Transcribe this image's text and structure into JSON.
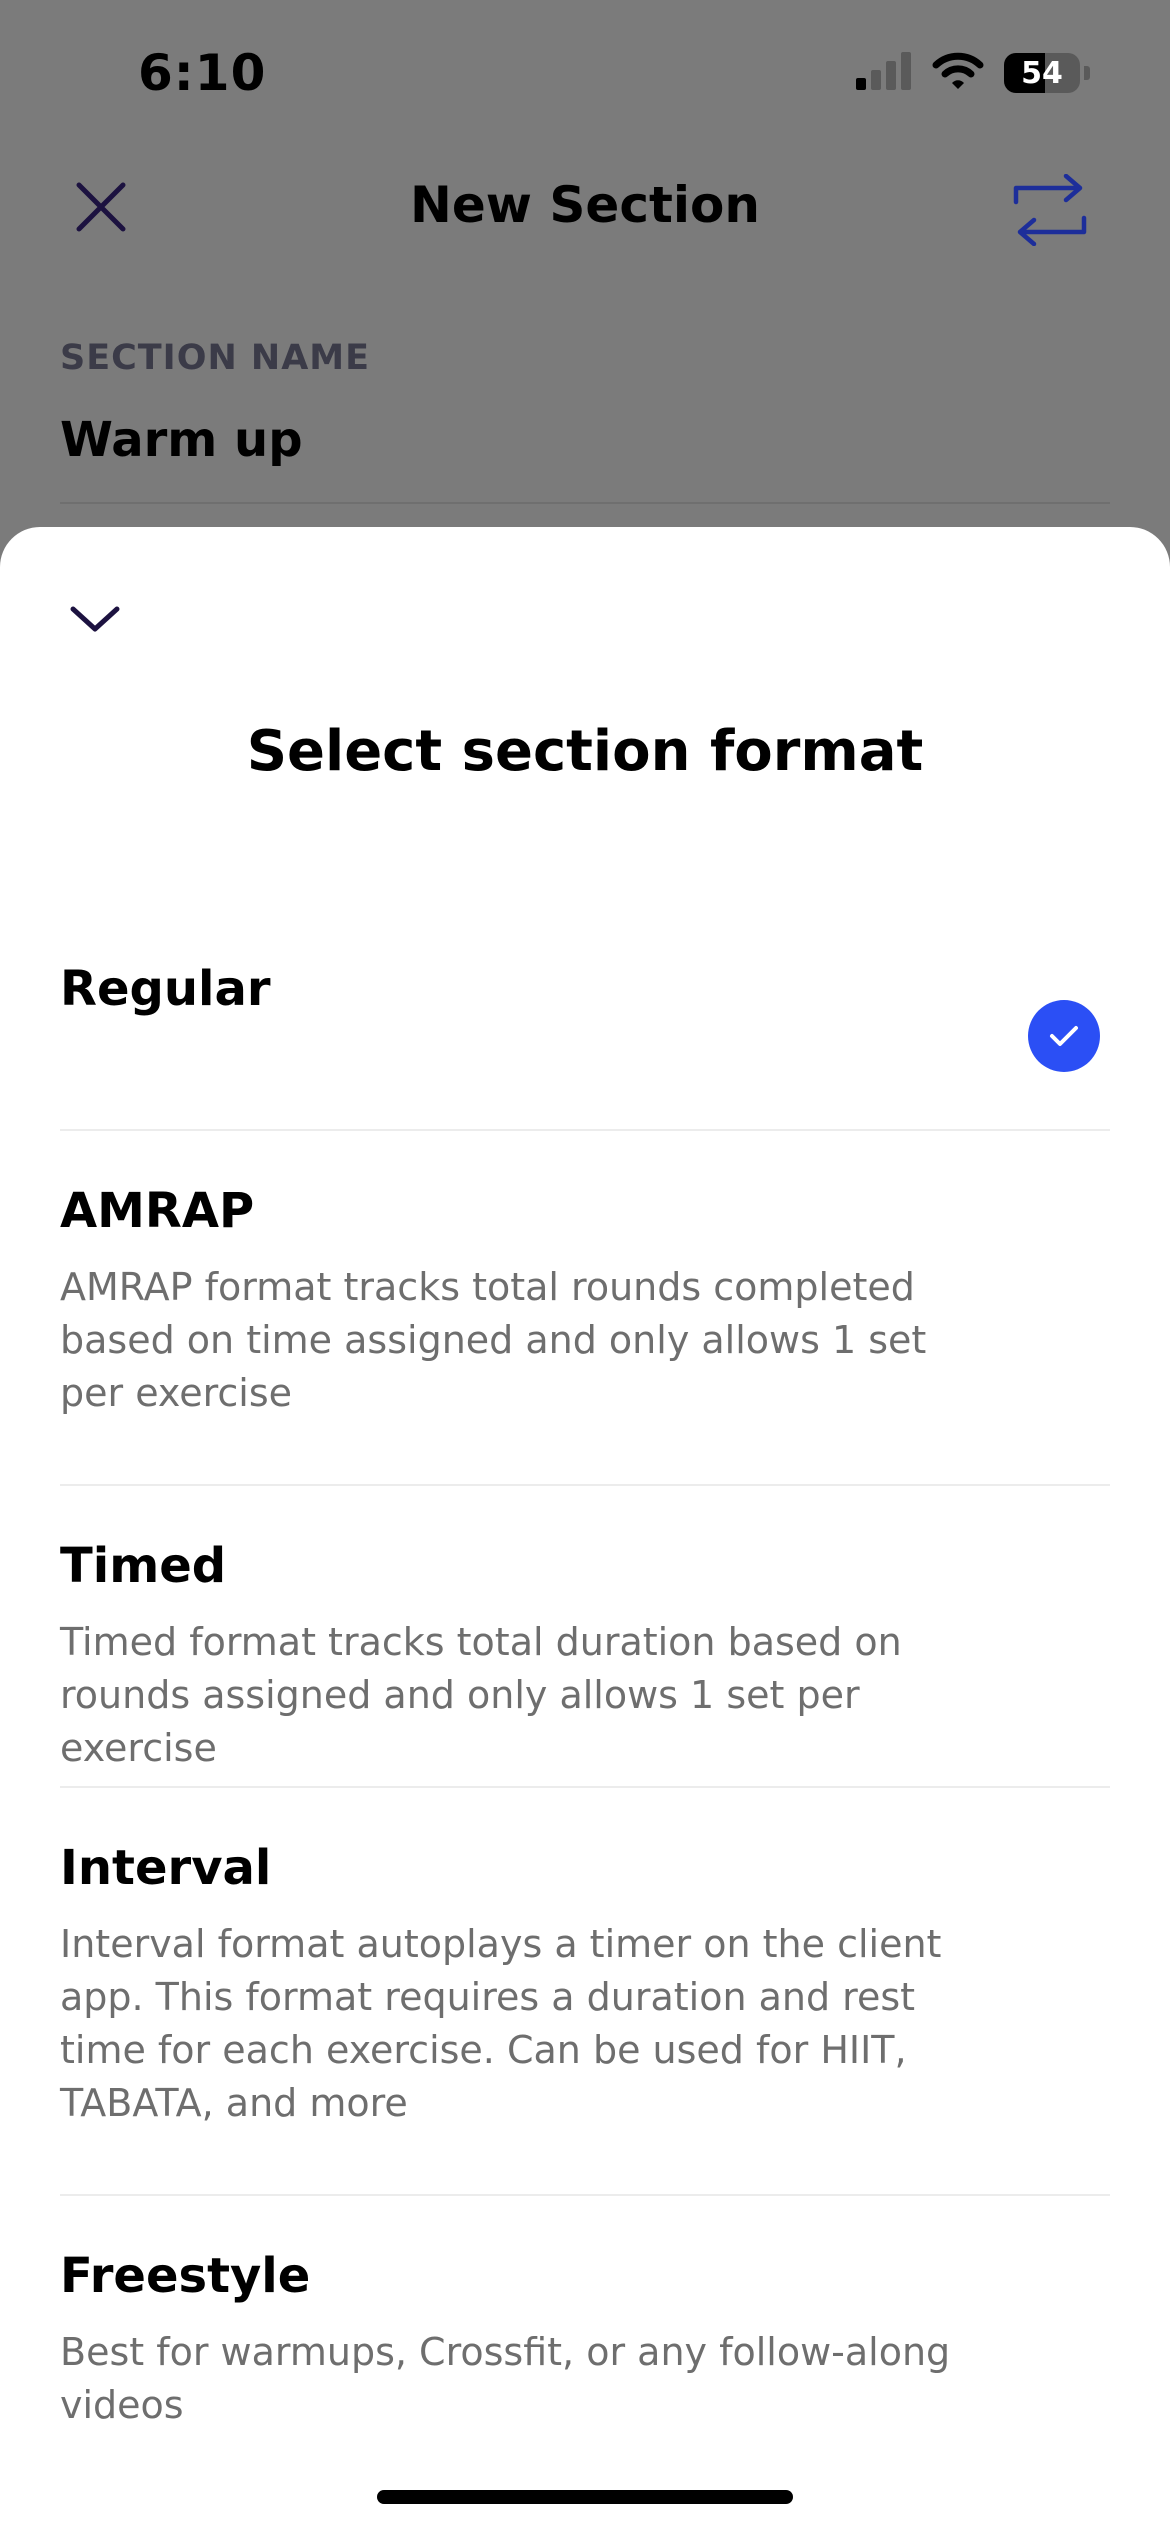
{
  "status_bar": {
    "time": "6:10",
    "battery": "54",
    "battery_level": 0.54,
    "icons": [
      "cellular-signal-icon",
      "wifi-icon",
      "battery-icon"
    ]
  },
  "header": {
    "title": "New Section",
    "close_icon": "close-icon",
    "swap_icon": "swap-icon"
  },
  "section": {
    "label": "SECTION NAME",
    "value": "Warm up"
  },
  "sheet": {
    "collapse_icon": "chevron-down-icon",
    "title": "Select section format",
    "options": [
      {
        "name": "Regular",
        "description": "",
        "selected": true
      },
      {
        "name": "AMRAP",
        "description": "AMRAP format tracks total rounds completed based on time assigned and only allows 1 set per exercise",
        "selected": false
      },
      {
        "name": "Timed",
        "description": "Timed format tracks total duration based on rounds assigned and only allows 1 set per exercise",
        "selected": false
      },
      {
        "name": "Interval",
        "description": "Interval format autoplays a timer on the client app. This format requires a duration and rest time for each exercise. Can be used for HIIT, TABATA, and more",
        "selected": false
      },
      {
        "name": "Freestyle",
        "description": "Best for warmups, Crossfit, or any follow-along videos",
        "selected": false
      }
    ]
  },
  "colors": {
    "accent": "#2b4ff5",
    "icon_dark": "#1c1240",
    "swap_icon": "#1d2e9a"
  }
}
